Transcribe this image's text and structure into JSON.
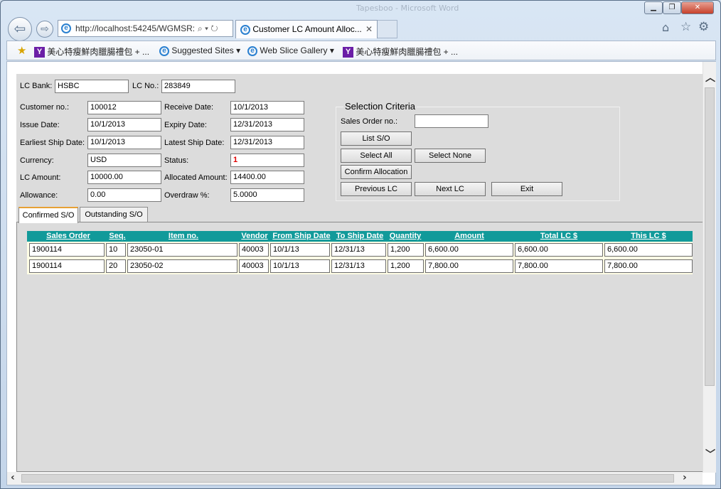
{
  "browser": {
    "faded_title": "Tapesboo - Microsoft Word",
    "address": "http://localhost:54245/WGMSR:",
    "address_icons": "⌕ ▾ ↻",
    "tab_title": "Customer LC Amount Alloc...",
    "tab_close": "✕",
    "favorites": [
      {
        "label": "美心特瘦鮮肉臘腸禮包 + ...",
        "icon": "yahoo-icon"
      },
      {
        "label": "Suggested Sites ▾",
        "icon": "ie-icon"
      },
      {
        "label": "Web Slice Gallery ▾",
        "icon": "ie-icon"
      },
      {
        "label": "美心特瘦鮮肉臘腸禮包 + ...",
        "icon": "yahoo-icon"
      }
    ]
  },
  "form": {
    "lc_bank_label": "LC Bank:",
    "lc_bank_value": "HSBC",
    "lc_no_label": "LC No.:",
    "lc_no_value": "283849",
    "customer_no_label": "Customer no.:",
    "customer_no_value": "100012",
    "receive_date_label": "Receive Date:",
    "receive_date_value": "10/1/2013",
    "issue_date_label": "Issue Date:",
    "issue_date_value": "10/1/2013",
    "expiry_date_label": "Expiry Date:",
    "expiry_date_value": "12/31/2013",
    "earliest_ship_label": "Earliest Ship Date:",
    "earliest_ship_value": "10/1/2013",
    "latest_ship_label": "Latest Ship Date:",
    "latest_ship_value": "12/31/2013",
    "currency_label": "Currency:",
    "currency_value": "USD",
    "status_label": "Status:",
    "status_value": "1",
    "lc_amount_label": "LC Amount:",
    "lc_amount_value": "10000.00",
    "allocated_label": "Allocated Amount:",
    "allocated_value": "14400.00",
    "allowance_label": "Allowance:",
    "allowance_value": "0.00",
    "overdraw_label": "Overdraw %:",
    "overdraw_value": "5.0000"
  },
  "selection": {
    "legend": "Selection Criteria",
    "sales_order_label": "Sales Order no.:",
    "sales_order_value": "",
    "list_so": "List S/O",
    "select_all": "Select All",
    "select_none": "Select None",
    "confirm_allocation": "Confirm Allocation",
    "previous_lc": "Previous LC",
    "next_lc": "Next LC",
    "exit": "Exit"
  },
  "tabs": {
    "confirmed": "Confirmed S/O",
    "outstanding": "Outstanding S/O"
  },
  "grid": {
    "headers": [
      "Sales Order",
      "Seq.",
      "Item no.",
      "Vendor",
      "From Ship Date",
      "To Ship Date",
      "Quantity",
      "Amount",
      "Total LC $",
      "This LC $"
    ],
    "rows": [
      [
        "1900114",
        "10",
        "23050-01",
        "40003",
        "10/1/13",
        "12/31/13",
        "1,200",
        "6,600.00",
        "6,600.00",
        "6,600.00"
      ],
      [
        "1900114",
        "20",
        "23050-02",
        "40003",
        "10/1/13",
        "12/31/13",
        "1,200",
        "7,800.00",
        "7,800.00",
        "7,800.00"
      ]
    ]
  },
  "colors": {
    "grid_header": "#119a9a",
    "status_value": "#e00000",
    "active_tab_accent": "#e7a035"
  }
}
